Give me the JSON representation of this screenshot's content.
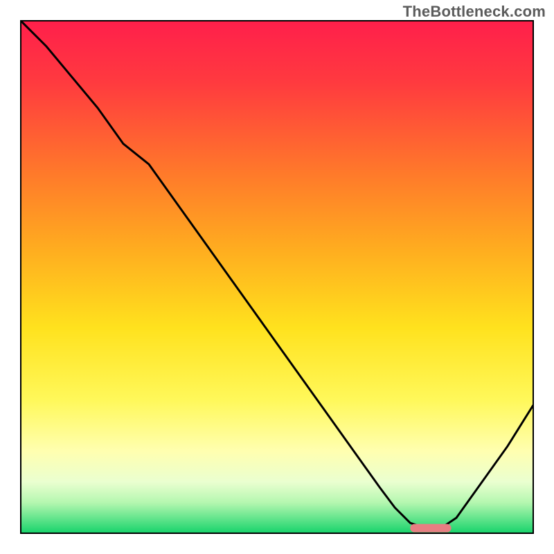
{
  "watermark": "TheBottleneck.com",
  "colors": {
    "curve": "#000000",
    "marker": "#e77e82",
    "gradient_top": "#ff1f4b",
    "gradient_bottom": "#17d36b"
  },
  "chart_data": {
    "type": "line",
    "title": "",
    "xlabel": "",
    "ylabel": "",
    "xlim": [
      0,
      100
    ],
    "ylim": [
      0,
      100
    ],
    "x": [
      0,
      5,
      10,
      15,
      20,
      25,
      30,
      35,
      40,
      45,
      50,
      55,
      60,
      65,
      70,
      73,
      76,
      79,
      82,
      85,
      90,
      95,
      100
    ],
    "values": [
      100,
      95,
      89,
      83,
      76,
      72,
      65,
      58,
      51,
      44,
      37,
      30,
      23,
      16,
      9,
      5,
      2,
      1,
      1,
      3,
      10,
      17,
      25
    ],
    "optimum_x_range": [
      76,
      84
    ],
    "optimum_y": 1
  }
}
